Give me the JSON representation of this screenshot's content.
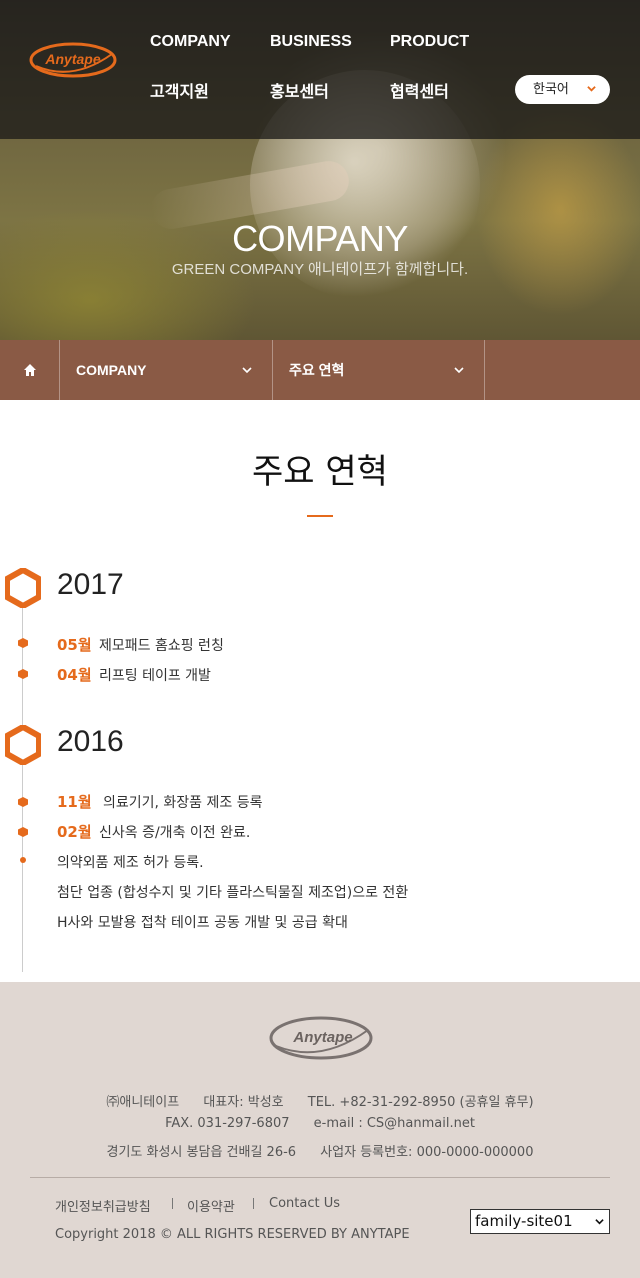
{
  "colors": {
    "accent": "#e56a1c",
    "breadcrumb_bg": "#8a5a45",
    "footer_bg": "#e0d7d2",
    "header_overlay": "#1e1c1a"
  },
  "header": {
    "logo_text": "Anytape",
    "nav": [
      "COMPANY",
      "BUSINESS",
      "PRODUCT",
      "고객지원",
      "홍보센터",
      "협력센터"
    ],
    "language": {
      "selected": "한국어",
      "icon": "chevron-down-icon"
    }
  },
  "hero": {
    "title": "COMPANY",
    "subtitle": "GREEN COMPANY 애니테이프가 함께합니다."
  },
  "breadcrumb": {
    "home_icon": "home-icon",
    "level1": "COMPANY",
    "level2": "주요 연혁"
  },
  "main": {
    "title": "주요 연혁"
  },
  "timeline": [
    {
      "year": "2017",
      "items": [
        {
          "month": "05월",
          "lines": [
            "제모패드 홈쇼핑 런칭"
          ]
        },
        {
          "month": "04월",
          "lines": [
            "리프팅 테이프 개발"
          ]
        }
      ]
    },
    {
      "year": "2016",
      "items": [
        {
          "month": "11월",
          "lines": [
            "의료기기, 화장품 제조 등록"
          ]
        },
        {
          "month": "02월",
          "lines": [
            "신사옥 증/개축 이전 완료.",
            "의약외품 제조 허가 등록.",
            "첨단 업종 (합성수지 및 기타 플라스틱물질 제조업)으로 전환",
            "H사와 모발용 접착 테이프 공동 개발 및 공급 확대"
          ]
        }
      ]
    }
  ],
  "footer": {
    "logo_text": "Anytape",
    "company": "㈜애니테이프",
    "ceo": "대표자: 박성호",
    "tel": "TEL. +82-31-292-8950 (공휴일 휴무)",
    "fax": "FAX. 031-297-6807",
    "email": "e-mail : CS@hanmail.net",
    "address": "경기도 화성시 봉담읍 건배길 26-6",
    "biz_no": "사업자 등록번호: 000-0000-000000",
    "links": [
      "개인정보취급방침",
      "이용약관",
      "Contact Us"
    ],
    "copyright": "Copyright 2018 © ALL RIGHTS RESERVED BY ANYTAPE",
    "family_site": "family-site01"
  }
}
